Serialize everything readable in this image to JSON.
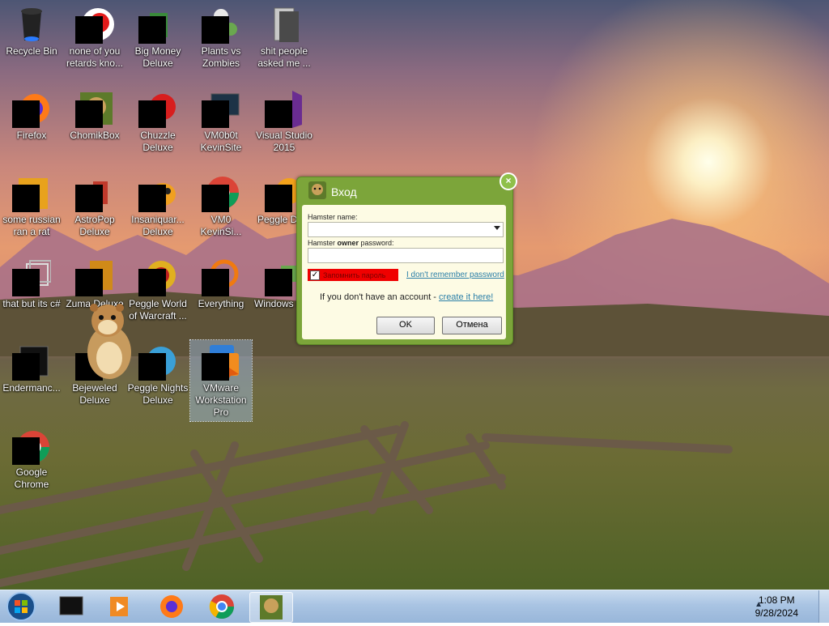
{
  "desktop": {
    "icons": [
      {
        "label": "Recycle Bin",
        "icon": "recycle-bin-icon"
      },
      {
        "label": "none of you retards kno...",
        "icon": "app-icon"
      },
      {
        "label": "Big Money Deluxe",
        "icon": "game-icon"
      },
      {
        "label": "Plants vs Zombies",
        "icon": "game-icon"
      },
      {
        "label": "shit people asked me ...",
        "icon": "folder-icon"
      },
      {
        "label": "Firefox",
        "icon": "firefox-icon"
      },
      {
        "label": "ChomikBox",
        "icon": "chomikbox-icon"
      },
      {
        "label": "Chuzzle Deluxe",
        "icon": "game-icon"
      },
      {
        "label": "VM0b0t KevinSite",
        "icon": "monitor-icon"
      },
      {
        "label": "Visual Studio 2015",
        "icon": "visual-studio-icon"
      },
      {
        "label": "some russian ran a rat",
        "icon": "app-icon"
      },
      {
        "label": "AstroPop Deluxe",
        "icon": "game-icon"
      },
      {
        "label": "Insaniquar... Deluxe",
        "icon": "game-icon"
      },
      {
        "label": "VM0 KevinSi...",
        "icon": "chrome-icon"
      },
      {
        "label": "Peggle De...",
        "icon": "game-icon"
      },
      {
        "label": "that but its c#",
        "icon": "app-icon"
      },
      {
        "label": "Zuma Deluxe",
        "icon": "game-icon"
      },
      {
        "label": "Peggle World of Warcraft ...",
        "icon": "game-icon"
      },
      {
        "label": "Everything",
        "icon": "search-icon"
      },
      {
        "label": "Windows Mail",
        "icon": "mail-icon"
      },
      {
        "label": "Endermanc...",
        "icon": "app-icon"
      },
      {
        "label": "Bejeweled Deluxe",
        "icon": "game-icon"
      },
      {
        "label": "Peggle Nights Deluxe",
        "icon": "game-icon"
      },
      {
        "label": "VMware Workstation Pro",
        "icon": "vmware-icon"
      },
      {
        "label": "Google Chrome",
        "icon": "chrome-icon"
      }
    ]
  },
  "dialog": {
    "title": "Вход",
    "close_glyph": "×",
    "name_label": "Hamster name:",
    "name_value": "",
    "password_label_pre": "Hamster ",
    "password_label_bold": "owner",
    "password_label_post": " password:",
    "password_value": "",
    "remember_label": "Запомнить пароль",
    "remember_checked": true,
    "forgot_link": "I don't remember password",
    "no_account_text": "If you don't have an account - ",
    "create_link": "create it here!",
    "ok_label": "OK",
    "cancel_label": "Отмена",
    "accent_color": "#7ca53a"
  },
  "taskbar": {
    "items": [
      "start-button",
      "terminal",
      "media-player",
      "firefox",
      "chrome",
      "chomikbox"
    ],
    "tray_arrow": "▲",
    "time": "1:08 PM",
    "date": "9/28/2024"
  }
}
